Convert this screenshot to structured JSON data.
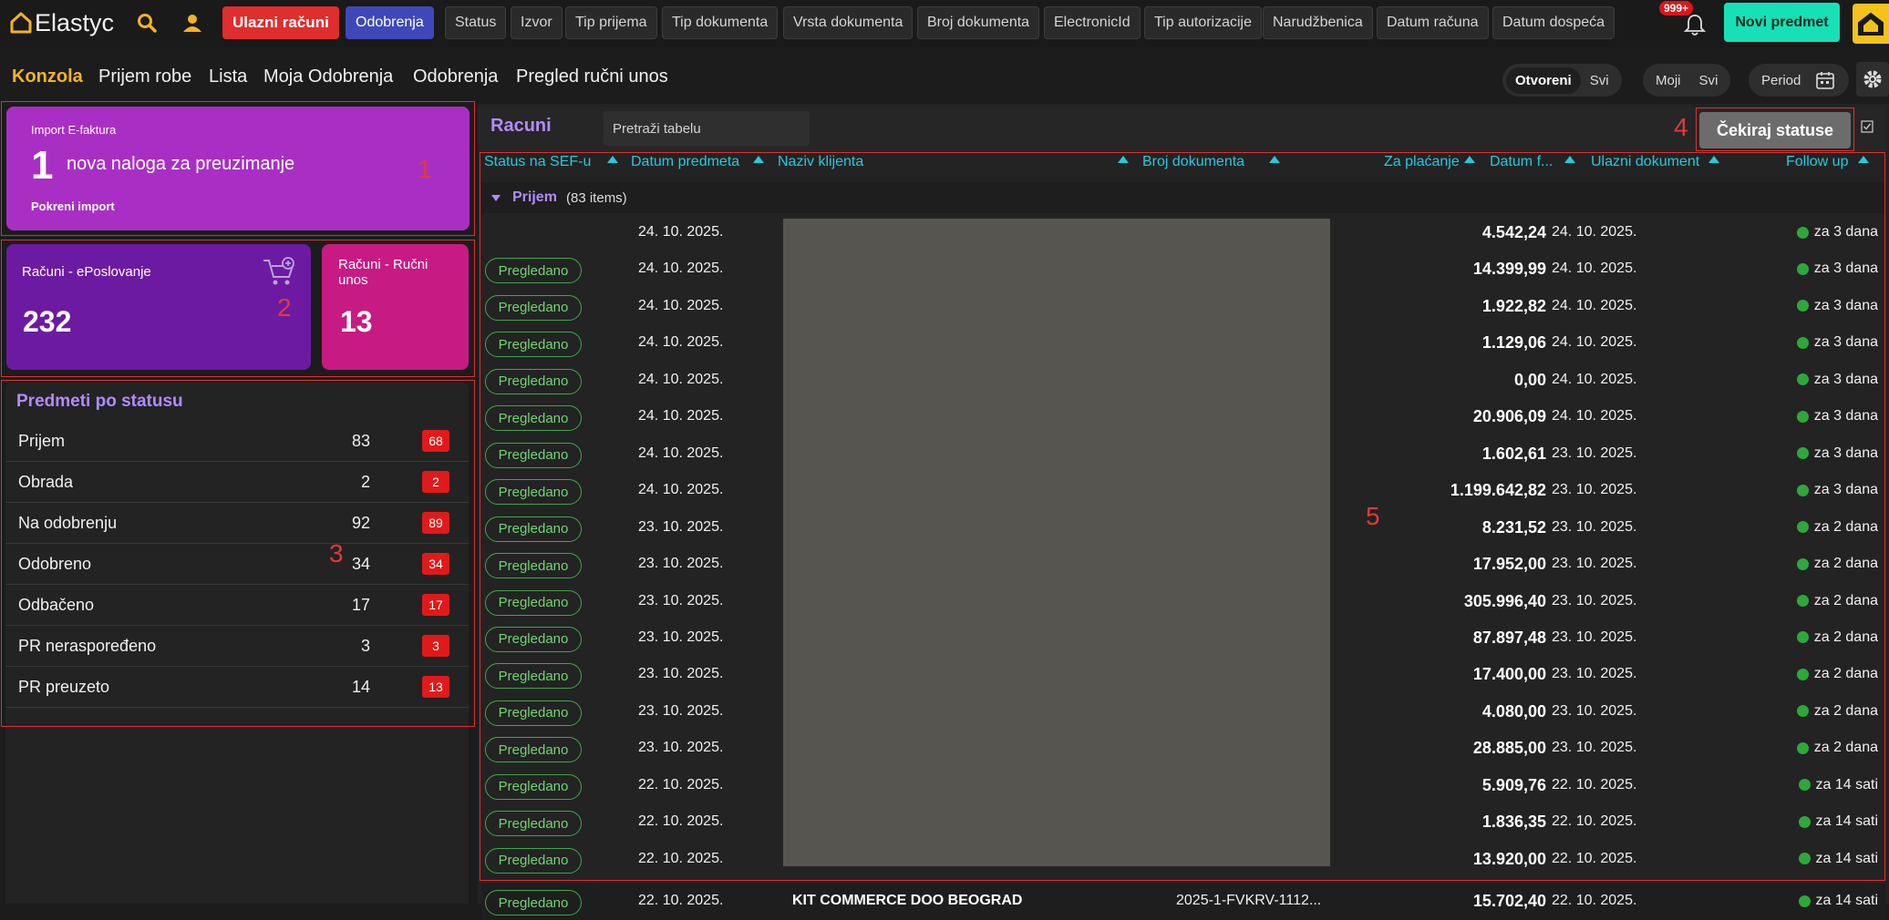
{
  "topbar": {
    "logo": "Elastyc",
    "ulazni": "Ulazni računi",
    "odobrenja": "Odobrenja",
    "filters": [
      "Status",
      "Izvor",
      "Tip prijema",
      "Tip dokumenta",
      "Vrsta dokumenta",
      "Broj dokumenta",
      "ElectronicId",
      "Tip autorizacije",
      "Narudžbenica",
      "Datum računa",
      "Datum dospeća"
    ],
    "notif": "999+",
    "new_btn": "Novi predmet"
  },
  "nav": {
    "items": [
      "Konzola",
      "Prijem robe",
      "Lista",
      "Moja Odobrenja",
      "Odobrenja",
      "Pregled ručni unos"
    ],
    "seg1": [
      "Otvoreni",
      "Svi"
    ],
    "seg2": [
      "Moji",
      "Svi"
    ],
    "period": "Period"
  },
  "import": {
    "title": "Import E-faktura",
    "count": "1",
    "text": "nova naloga za preuzimanje",
    "action": "Pokreni import"
  },
  "cards": {
    "eposl_label": "Računi - ePoslovanje",
    "eposl_value": "232",
    "rucni_label": "Računi - Ručni unos",
    "rucni_value": "13"
  },
  "status_panel": {
    "title": "Predmeti po statusu",
    "rows": [
      {
        "label": "Prijem",
        "count": "83",
        "badge": "68"
      },
      {
        "label": "Obrada",
        "count": "2",
        "badge": "2"
      },
      {
        "label": "Na odobrenju",
        "count": "92",
        "badge": "89"
      },
      {
        "label": "Odobreno",
        "count": "34",
        "badge": "34"
      },
      {
        "label": "Odbačeno",
        "count": "17",
        "badge": "17"
      },
      {
        "label": "PR neraspoređeno",
        "count": "3",
        "badge": "3"
      },
      {
        "label": "PR preuzeto",
        "count": "14",
        "badge": "13"
      }
    ]
  },
  "annotations": [
    "1",
    "2",
    "3",
    "4",
    "5"
  ],
  "table": {
    "title": "Racuni",
    "search_placeholder": "Pretraži tabelu",
    "check_btn": "Čekiraj statuse",
    "headers": [
      "Status na SEF-u",
      "Datum predmeta",
      "Naziv klijenta",
      "Broj dokumenta",
      "Za plaćanje",
      "Datum f...",
      "Ulazni dokument",
      "Follow up"
    ],
    "group": "Prijem",
    "group_count": "(83 items)",
    "rows": [
      {
        "status": "",
        "date": "24. 10. 2025.",
        "amount": "4.542,24",
        "due": "24. 10. 2025.",
        "fu": "za 3 dana"
      },
      {
        "status": "Pregledano",
        "date": "24. 10. 2025.",
        "amount": "14.399,99",
        "due": "24. 10. 2025.",
        "fu": "za 3 dana"
      },
      {
        "status": "Pregledano",
        "date": "24. 10. 2025.",
        "amount": "1.922,82",
        "due": "24. 10. 2025.",
        "fu": "za 3 dana"
      },
      {
        "status": "Pregledano",
        "date": "24. 10. 2025.",
        "amount": "1.129,06",
        "due": "24. 10. 2025.",
        "fu": "za 3 dana"
      },
      {
        "status": "Pregledano",
        "date": "24. 10. 2025.",
        "amount": "0,00",
        "due": "24. 10. 2025.",
        "fu": "za 3 dana"
      },
      {
        "status": "Pregledano",
        "date": "24. 10. 2025.",
        "amount": "20.906,09",
        "due": "24. 10. 2025.",
        "fu": "za 3 dana"
      },
      {
        "status": "Pregledano",
        "date": "24. 10. 2025.",
        "amount": "1.602,61",
        "due": "23. 10. 2025.",
        "fu": "za 3 dana"
      },
      {
        "status": "Pregledano",
        "date": "24. 10. 2025.",
        "amount": "1.199.642,82",
        "due": "23. 10. 2025.",
        "fu": "za 3 dana"
      },
      {
        "status": "Pregledano",
        "date": "23. 10. 2025.",
        "amount": "8.231,52",
        "due": "23. 10. 2025.",
        "fu": "za 2 dana"
      },
      {
        "status": "Pregledano",
        "date": "23. 10. 2025.",
        "amount": "17.952,00",
        "due": "23. 10. 2025.",
        "fu": "za 2 dana"
      },
      {
        "status": "Pregledano",
        "date": "23. 10. 2025.",
        "amount": "305.996,40",
        "due": "23. 10. 2025.",
        "fu": "za 2 dana"
      },
      {
        "status": "Pregledano",
        "date": "23. 10. 2025.",
        "amount": "87.897,48",
        "due": "23. 10. 2025.",
        "fu": "za 2 dana"
      },
      {
        "status": "Pregledano",
        "date": "23. 10. 2025.",
        "amount": "17.400,00",
        "due": "23. 10. 2025.",
        "fu": "za 2 dana"
      },
      {
        "status": "Pregledano",
        "date": "23. 10. 2025.",
        "amount": "4.080,00",
        "due": "23. 10. 2025.",
        "fu": "za 2 dana"
      },
      {
        "status": "Pregledano",
        "date": "23. 10. 2025.",
        "amount": "28.885,00",
        "due": "23. 10. 2025.",
        "fu": "za 2 dana"
      },
      {
        "status": "Pregledano",
        "date": "22. 10. 2025.",
        "amount": "5.909,76",
        "due": "22. 10. 2025.",
        "fu": "za 14 sati"
      },
      {
        "status": "Pregledano",
        "date": "22. 10. 2025.",
        "amount": "1.836,35",
        "due": "22. 10. 2025.",
        "fu": "za 14 sati"
      },
      {
        "status": "Pregledano",
        "date": "22. 10. 2025.",
        "amount": "13.920,00",
        "due": "22. 10. 2025.",
        "fu": "za 14 sati"
      }
    ],
    "last_row": {
      "status": "Pregledano",
      "date": "22. 10. 2025.",
      "client": "KIT COMMERCE DOO BEOGRAD",
      "doc": "2025-1-FVKRV-1112...",
      "amount": "15.702,40",
      "due": "22. 10. 2025.",
      "fu": "za 14 sati"
    }
  }
}
